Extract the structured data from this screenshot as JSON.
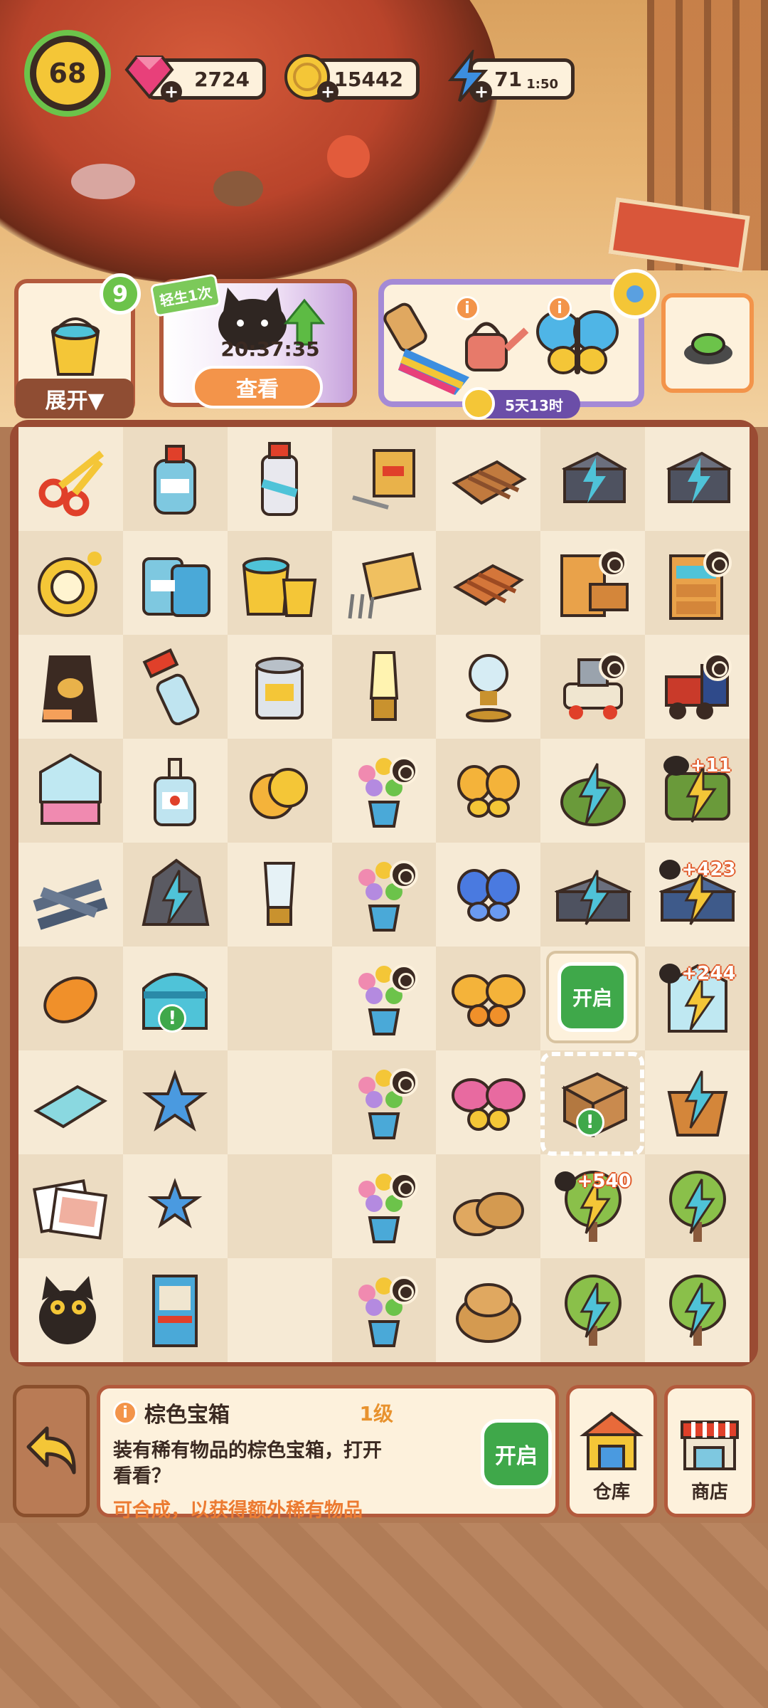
{
  "hud": {
    "level": "68",
    "gems": "2724",
    "coins": "15442",
    "energy": "71",
    "energy_timer": "1:50"
  },
  "quests": {
    "order_count": "9",
    "expand_label": "展开▼",
    "event_tag": "轻生1次",
    "event_timer": "20:37:35",
    "view_label": "查看",
    "quest_timer": "5天13时"
  },
  "board": {
    "bonus_1": "+11",
    "bonus_2": "+423",
    "bonus_3": "+244",
    "bonus_4": "+540",
    "open_bubble_label": "开启",
    "exclaim": "!"
  },
  "info": {
    "name": "棕色宝箱",
    "level": "1级",
    "desc": "装有稀有物品的棕色宝箱，打开看看？",
    "hint": "可合成，以获得额外稀有物品",
    "open_label": "开启",
    "warehouse_label": "仓库",
    "shop_label": "商店"
  },
  "colors": {
    "accent_green": "#3fa84a",
    "accent_orange": "#f3944a",
    "frame_brown": "#b35a3c"
  }
}
